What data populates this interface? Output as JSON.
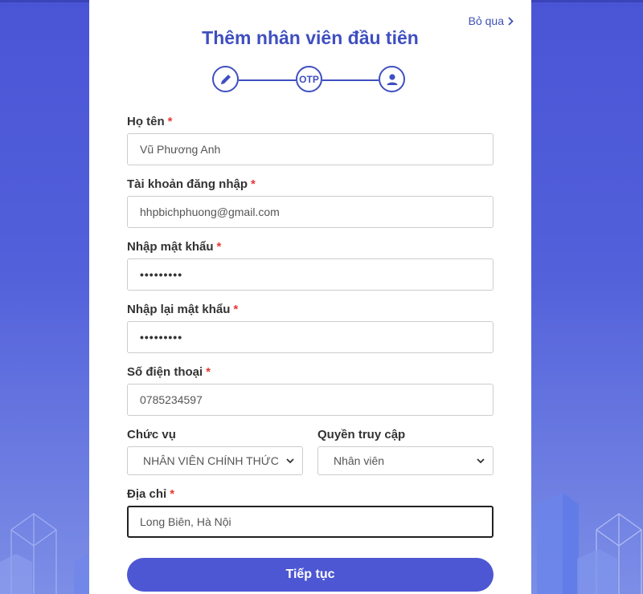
{
  "skip_label": "Bỏ qua",
  "title": "Thêm nhân viên đầu tiên",
  "steps": {
    "step1_icon": "pencil-icon",
    "step2_label": "OTP",
    "step3_icon": "user-icon"
  },
  "fields": {
    "name": {
      "label": "Họ tên",
      "required": "*",
      "value": "Vũ Phương Anh"
    },
    "account": {
      "label": "Tài khoản đăng nhập",
      "required": "*",
      "value": "hhpbichphuong@gmail.com"
    },
    "password": {
      "label": "Nhập mật khẩu",
      "required": "*",
      "value": "•••••••••"
    },
    "password_confirm": {
      "label": "Nhập lại mật khẩu",
      "required": "*",
      "value": "•••••••••"
    },
    "phone": {
      "label": "Số điện thoại",
      "required": "*",
      "value": "0785234597"
    },
    "position": {
      "label": "Chức vụ",
      "value": "NHÂN VIÊN CHÍNH THỨC"
    },
    "access": {
      "label": "Quyền truy cập",
      "value": "Nhân viên"
    },
    "address": {
      "label": "Địa chỉ",
      "required": "*",
      "value": "Long Biên, Hà Nội"
    }
  },
  "submit_label": "Tiếp tục",
  "colors": {
    "accent": "#3f4fc0",
    "button": "#4d57d3",
    "required": "#e53935",
    "background": "#4a55d6"
  }
}
